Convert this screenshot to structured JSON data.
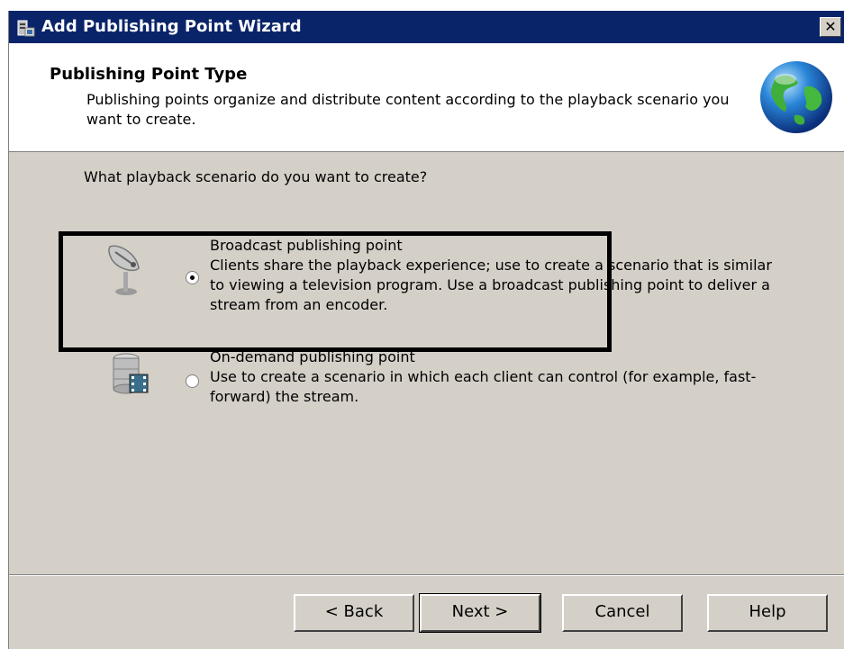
{
  "window": {
    "title": "Add Publishing Point Wizard",
    "close_label": "✕"
  },
  "header": {
    "title": "Publishing Point Type",
    "description": "Publishing points organize and distribute content according to the playback scenario you want to create."
  },
  "main": {
    "question": "What playback scenario do you want to create?",
    "options": [
      {
        "label": "Broadcast publishing point",
        "description": "Clients share the playback experience; use to create a scenario that is similar to viewing a television program. Use a broadcast publishing point to deliver a stream from an encoder.",
        "selected": true,
        "icon": "satellite-dish-icon"
      },
      {
        "label": "On-demand publishing point",
        "description": "Use to create a scenario in which each client can control (for example, fast-forward) the stream.",
        "selected": false,
        "icon": "server-film-icon"
      }
    ]
  },
  "footer": {
    "back_label": "< Back",
    "next_label": "Next >",
    "cancel_label": "Cancel",
    "help_label": "Help"
  },
  "colors": {
    "titlebar": "#0a246a",
    "dialog_bg": "#d4d0c8",
    "annotation_box": "#000000"
  }
}
